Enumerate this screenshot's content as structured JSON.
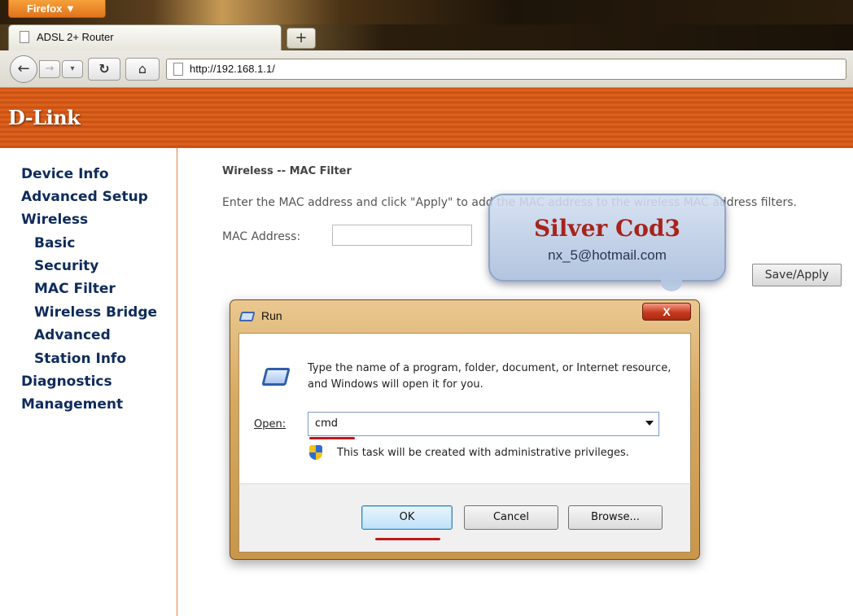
{
  "browser": {
    "app_menu_label": "Firefox ▼",
    "tab_title": "ADSL 2+ Router",
    "new_tab_label": "+",
    "url": "http://192.168.1.1/",
    "icons": [
      "back-icon",
      "forward-icon",
      "history-dropdown-icon",
      "reload-icon",
      "home-icon",
      "page-icon"
    ]
  },
  "router": {
    "logo_text": "D-Link",
    "brand_color": "#d55a17",
    "nav_color": "#0e2b5a",
    "sidebar": {
      "items": [
        {
          "label": "Device Info"
        },
        {
          "label": "Advanced Setup"
        },
        {
          "label": "Wireless"
        },
        {
          "label": "Basic"
        },
        {
          "label": "Security"
        },
        {
          "label": "MAC Filter"
        },
        {
          "label": "Wireless Bridge"
        },
        {
          "label": "Advanced"
        },
        {
          "label": "Station Info"
        },
        {
          "label": "Diagnostics"
        },
        {
          "label": "Management"
        }
      ]
    },
    "main": {
      "title": "Wireless -- MAC Filter",
      "instruction": "Enter the MAC address and click \"Apply\" to add the MAC address to the wireless MAC address filters.",
      "mac_label": "MAC Address:",
      "mac_value": "",
      "save_apply_label": "Save/Apply"
    }
  },
  "watermark": {
    "title": "Silver Cod3",
    "email": "nx_5@hotmail.com",
    "title_color": "#a6241c"
  },
  "run_dialog": {
    "title": "Run",
    "close_label": "X",
    "description": "Type the name of a program, folder, document, or Internet resource, and Windows will open it for you.",
    "open_label": "Open:",
    "open_value": "cmd",
    "admin_note": "This task will be created with administrative privileges.",
    "ok_label": "OK",
    "cancel_label": "Cancel",
    "browse_label": "Browse...",
    "annotation_color": "#c01818"
  }
}
